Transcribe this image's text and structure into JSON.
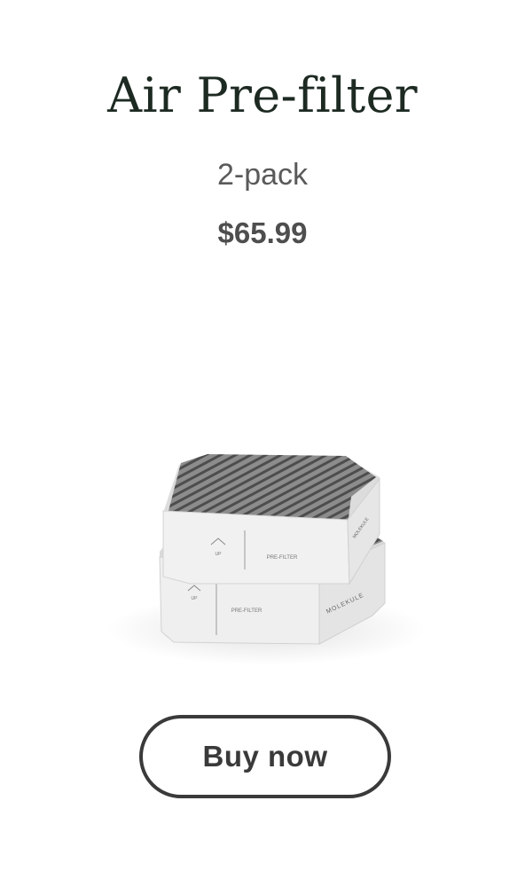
{
  "product": {
    "title": "Air Pre-filter",
    "variant": "2-pack",
    "price": "$65.99",
    "image": {
      "top_label_up": "UP",
      "top_label_name": "PRE-FILTER",
      "top_brand": "MOLEKULE",
      "bottom_label_up": "UP",
      "bottom_label_name": "PRE-FILTER",
      "bottom_brand": "MOLEKULE"
    }
  },
  "cta": {
    "buy_label": "Buy now"
  }
}
